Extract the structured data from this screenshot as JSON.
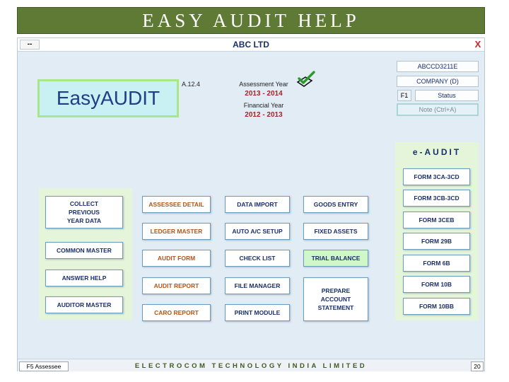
{
  "banner": {
    "title": "EASY AUDIT HELP"
  },
  "window": {
    "minimize_label": "--",
    "title": "ABC LTD",
    "close_label": "X"
  },
  "logo": {
    "text": "EasyAUDIT"
  },
  "version": "A.12.4",
  "assessment": {
    "assessment_year_label": "Assessment Year",
    "assessment_year": "2013 - 2014",
    "financial_year_label": "Financial Year",
    "financial_year": "2012 - 2013"
  },
  "info": {
    "code": "ABCCD3211E",
    "company": "COMPANY (D)",
    "f1_label": "F1",
    "status_label": "Status",
    "note_label": "Note (Ctrl+A)"
  },
  "left_panel": {
    "collect_prev": "COLLECT\nPREVIOUS\nYEAR DATA",
    "common_master": "COMMON MASTER",
    "answer_help": "ANSWER HELP",
    "auditor_master": "AUDITOR MASTER"
  },
  "grid": {
    "col1": [
      "ASSESSEE DETAIL",
      "LEDGER MASTER",
      "AUDIT FORM",
      "AUDIT REPORT",
      "CARO REPORT"
    ],
    "col2": [
      "DATA IMPORT",
      "AUTO A/C SETUP",
      "CHECK LIST",
      "FILE MANAGER",
      "PRINT MODULE"
    ],
    "col3": [
      "GOODS ENTRY",
      "FIXED ASSETS",
      "TRIAL BALANCE",
      "PREPARE\nACCOUNT\nSTATEMENT"
    ]
  },
  "eaudit": {
    "title": "e-AUDIT",
    "forms": [
      "FORM 3CA-3CD",
      "FORM 3CB-3CD",
      "FORM 3CEB",
      "FORM 29B",
      "FORM 6B",
      "FORM 10B",
      "FORM 10BB"
    ]
  },
  "status": {
    "f5_label": "F5 Assessee",
    "company_name": "ELECTROCOM TECHNOLOGY INDIA LIMITED",
    "page": "20"
  },
  "colors": {
    "banner_bg": "#5f7a35",
    "app_bg": "#e1ecf5",
    "panel_bg": "#e4f5da",
    "accent_blue": "#1a2f6b",
    "accent_red": "#b25418",
    "highlight_green": "#cff7c8"
  }
}
